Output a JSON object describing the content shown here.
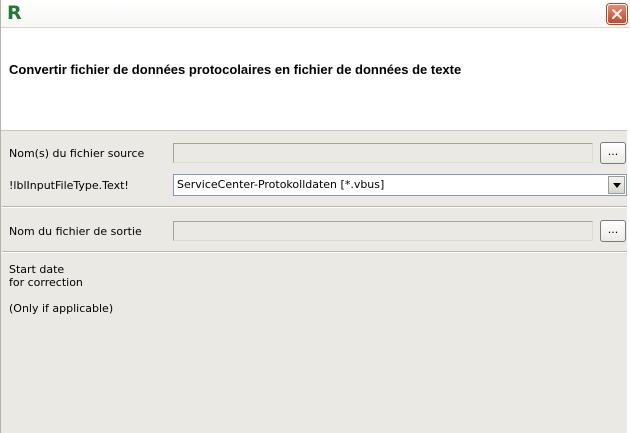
{
  "titlebar": {
    "logo_text": "R",
    "close_icon": "close-x-icon",
    "close_color": "#d9593a"
  },
  "header": {
    "title": "Convertir fichier de données protocolaires en fichier de données de texte"
  },
  "form": {
    "source_label": "Nom(s) du fichier source",
    "source_value": "",
    "browse_label": "...",
    "filetype_label": "!lblInputFileType.Text!",
    "filetype_selected": "ServiceCenter-Protokolldaten [*.vbus]",
    "output_label": "Nom du fichier de sortie",
    "output_value": "",
    "output_browse_label": "..."
  },
  "notes": {
    "start_line1": "Start date",
    "start_line2": "for correction",
    "only_if": "(Only if applicable)"
  }
}
